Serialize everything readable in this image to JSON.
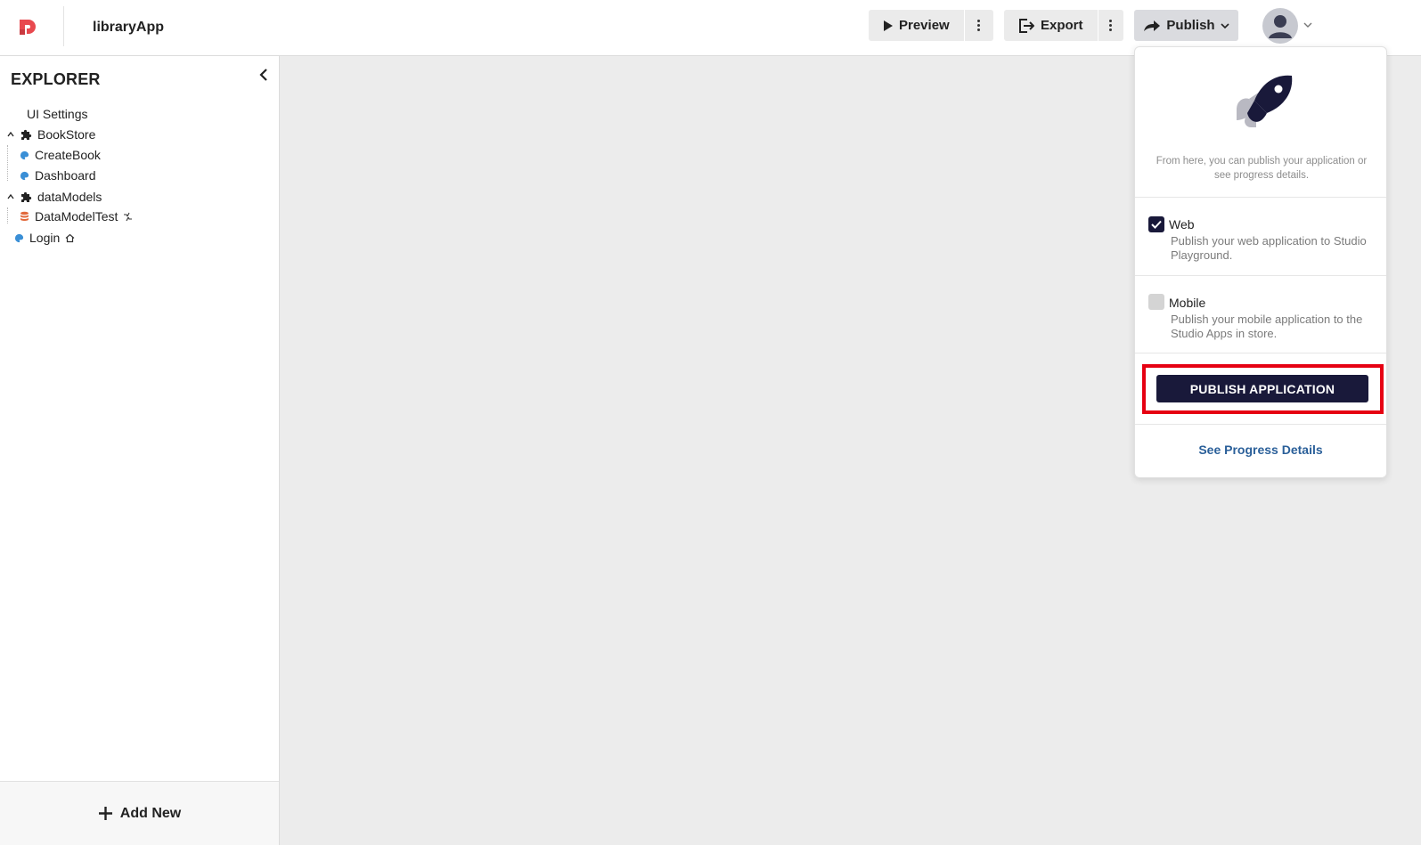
{
  "header": {
    "app_title": "libraryApp",
    "preview_label": "Preview",
    "export_label": "Export",
    "publish_label": "Publish"
  },
  "sidebar": {
    "title": "EXPLORER",
    "items": [
      {
        "label": "UI Settings"
      },
      {
        "label": "BookStore"
      },
      {
        "label": "CreateBook"
      },
      {
        "label": "Dashboard"
      },
      {
        "label": "dataModels"
      },
      {
        "label": "DataModelTest"
      },
      {
        "label": "Login"
      }
    ],
    "add_new_label": "Add New"
  },
  "publish_panel": {
    "description": "From here, you can publish your application or see progress details.",
    "options": [
      {
        "label": "Web",
        "description": "Publish your web application to Studio Playground.",
        "checked": true
      },
      {
        "label": "Mobile",
        "description": "Publish your mobile application to the Studio Apps in store.",
        "checked": false
      }
    ],
    "publish_button_label": "PUBLISH APPLICATION",
    "progress_link_label": "See Progress Details"
  },
  "colors": {
    "brand": "#e8494f",
    "primary_dark": "#19193a",
    "link": "#2a5f99",
    "highlight": "#e60012",
    "component_icon": "#3a8fd6",
    "data_icon": "#e2693c"
  }
}
